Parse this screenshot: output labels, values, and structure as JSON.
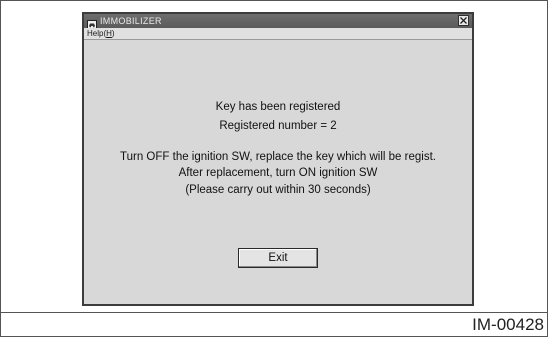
{
  "window": {
    "title": "IMMOBILIZER",
    "app_icon": "car-key-icon",
    "close_icon": "close-icon"
  },
  "menu": {
    "help_prefix": "Help(",
    "help_mnemonic": "H",
    "help_suffix": ")"
  },
  "message": {
    "line1": "Key has been registered",
    "line2": "Registered number = 2",
    "line3": "Turn OFF the ignition SW, replace the key which will be regist.",
    "line4": "After replacement, turn ON ignition SW",
    "line5": "(Please carry out within 30 seconds)"
  },
  "buttons": {
    "exit_label": "Exit"
  },
  "figure": {
    "id": "IM-00428"
  }
}
